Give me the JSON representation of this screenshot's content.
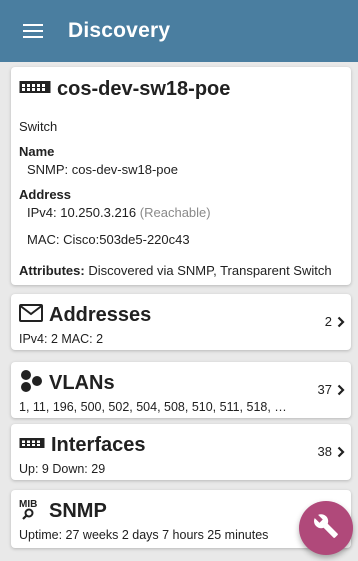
{
  "appbar": {
    "title": "Discovery",
    "menu_icon": "hamburger-menu-icon"
  },
  "device": {
    "name": "cos-dev-sw18-poe",
    "icon": "switch-icon",
    "type": "Switch",
    "name_label": "Name",
    "name_value": "SNMP:  cos-dev-sw18-poe",
    "address_label": "Address",
    "ipv4": "IPv4:  10.250.3.216",
    "ipv4_status": "(Reachable)",
    "mac": "MAC:  Cisco:503de5-220c43",
    "attributes_label": "Attributes:",
    "attributes_value": "Discovered via SNMP, Transparent Switch"
  },
  "addresses": {
    "title": "Addresses",
    "icon": "envelope-icon",
    "subtitle": "IPv4:  2    MAC:  2",
    "count": "2"
  },
  "vlans": {
    "title": "VLANs",
    "icon": "vlan-icon",
    "subtitle": "1, 11, 196, 500, 502, 504, 508, 510, 511, 518, …",
    "count": "37"
  },
  "interfaces": {
    "title": "Interfaces",
    "icon": "ethernet-port-icon",
    "subtitle": "Up: 9    Down: 29",
    "count": "38"
  },
  "snmp": {
    "title": "SNMP",
    "icon": "mib-icon",
    "mib_text": "MIB",
    "subtitle": "Uptime:  27 weeks 2 days 7 hours 25 minutes"
  },
  "fab": {
    "icon": "wrench-icon"
  },
  "colors": {
    "appbar": "#4a7ea0",
    "fab": "#b0497a",
    "reachable": "#8a8a8a"
  }
}
